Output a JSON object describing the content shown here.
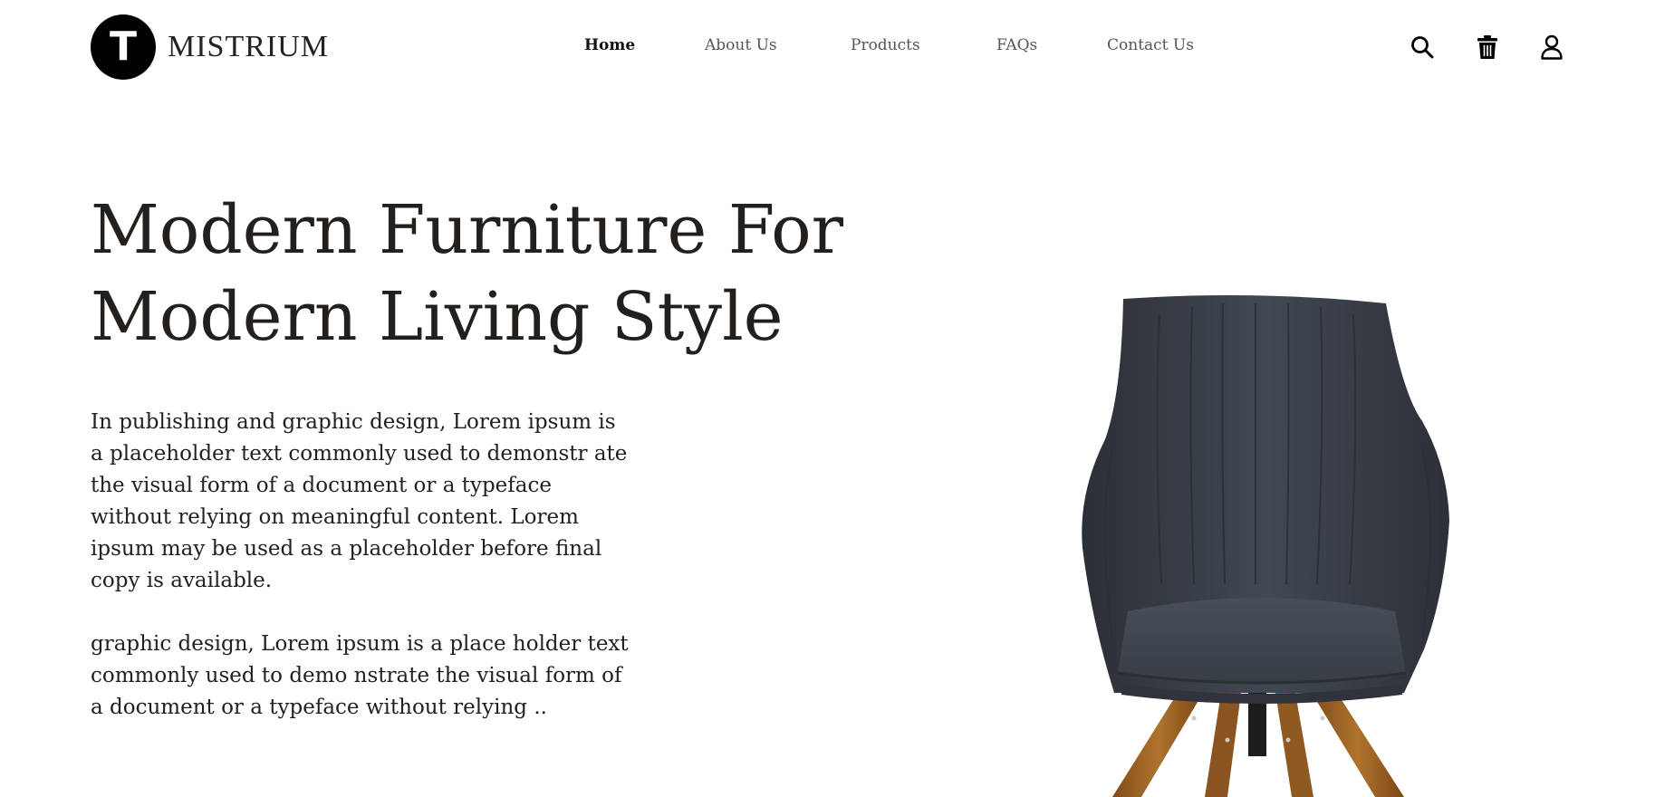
{
  "brand": {
    "logo_letter": "T",
    "name": "MISTRIUM"
  },
  "nav": {
    "items": [
      {
        "label": "Home",
        "active": true
      },
      {
        "label": "About Us"
      },
      {
        "label": "Products"
      },
      {
        "label": "FAQs"
      },
      {
        "label": "Contact Us"
      }
    ]
  },
  "icons": [
    "search-icon",
    "trash-icon",
    "user-icon"
  ],
  "hero": {
    "title_line1": "Modern Furniture For",
    "title_line2": "Modern Living Style",
    "paragraph1": "In publishing and graphic design, Lorem ipsum is a placeholder text commonly used to demonstr ate the visual form of a document or a typeface without relying on meaningful content. Lorem ipsum may be used as a placeholder before final copy is available.",
    "paragraph2": "graphic design, Lorem ipsum is a place holder text commonly used to demo nstrate the visual form of a document or a typeface without relying .."
  },
  "colors": {
    "text": "#231f1c",
    "nav_inactive": "#555555",
    "chair_fabric": "#3d424c",
    "chair_legs": "#9a6122"
  }
}
